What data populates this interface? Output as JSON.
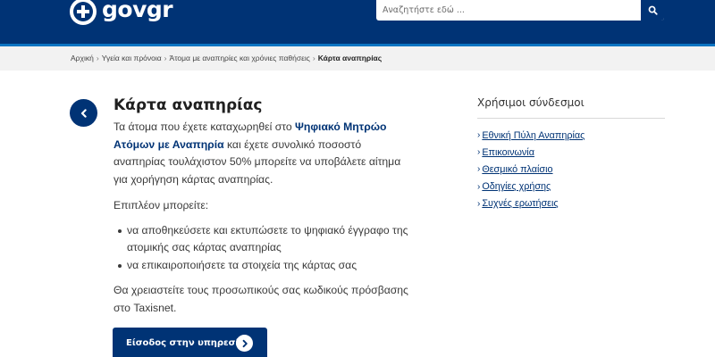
{
  "header": {
    "logo_text": "govgr",
    "search": {
      "placeholder": "Αναζητήστε εδώ ..."
    }
  },
  "breadcrumb": {
    "items": [
      "Αρχική",
      "Υγεία και πρόνοια",
      "Άτομα με αναπηρίες και χρόνιες παθήσεις"
    ],
    "current": "Κάρτα αναπηρίας"
  },
  "page": {
    "title": "Κάρτα αναπηρίας",
    "intro_before": "Τα άτομα που έχετε καταχωρηθεί στο ",
    "intro_link": "Ψηφιακό Μητρώο Ατόμων με Αναπηρία",
    "intro_after": " και έχετε συνολικό ποσοστό αναπηρίας τουλάχιστον 50% μπορείτε να υποβάλετε αίτημα για χορήγηση κάρτας αναπηρίας.",
    "more_label": "Επιπλέον μπορείτε:",
    "bullets": [
      "να αποθηκεύσετε και εκτυπώσετε το ψηφιακό έγγραφο της ατομικής σας κάρτας αναπηρίας",
      "να επικαιροποιήσετε τα στοιχεία της κάρτας σας"
    ],
    "credentials_note": "Θα χρειαστείτε τους προσωπικούς σας κωδικούς πρόσβασης στο Taxisnet.",
    "cta_label": "Είσοδος στην υπηρεσία"
  },
  "sidebar": {
    "title": "Χρήσιμοι σύνδεσμοι",
    "links": [
      {
        "label": "Εθνική Πύλη Αναπηρίας"
      },
      {
        "label": "Επικοινωνία"
      },
      {
        "label": "Θεσμικό πλαίσιο"
      },
      {
        "label": "Οδηγίες χρήσης"
      },
      {
        "label": "Συχνές ερωτήσεις"
      }
    ]
  },
  "colors": {
    "brand_navy": "#003375",
    "accent_blue": "#0a74c2",
    "breadcrumb_bg": "#f2f2f2"
  },
  "icons": {
    "logo": "greek-emblem-icon",
    "search": "search-icon",
    "back": "chevron-left-icon",
    "cta": "chevron-right-icon"
  }
}
